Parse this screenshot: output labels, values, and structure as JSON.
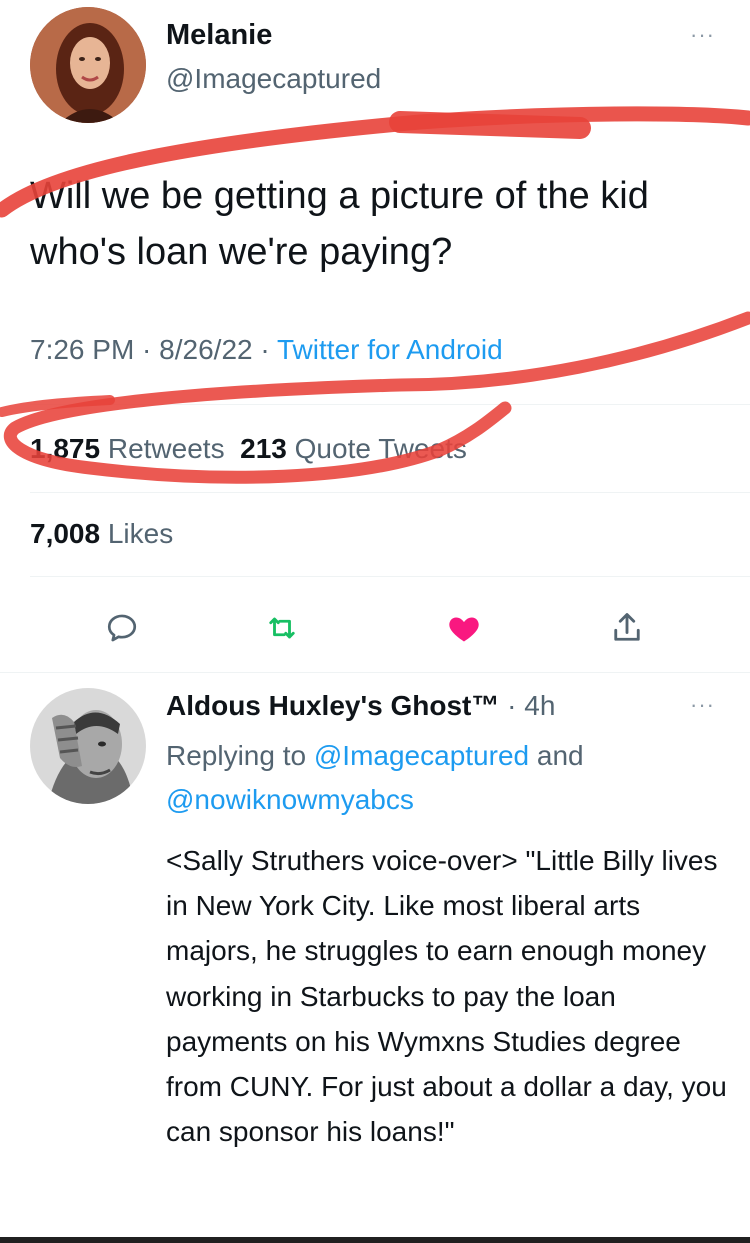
{
  "tweet": {
    "author_name": "Melanie",
    "author_handle": "@Imagecaptured",
    "more_label": "···",
    "text": "Will we be getting a picture of the kid who's loan we're paying?",
    "time": "7:26 PM",
    "date": "8/26/22",
    "source": "Twitter for Android",
    "separator": " · ",
    "retweets_count": "1,875",
    "retweets_label": "Retweets",
    "quotes_count": "213",
    "quotes_label": "Quote Tweets",
    "likes_count": "7,008",
    "likes_label": "Likes"
  },
  "actions": {
    "reply_icon": "speech-bubble-icon",
    "retweet_icon": "retweet-icon",
    "like_icon": "heart-icon",
    "share_icon": "share-icon",
    "liked": true
  },
  "reply": {
    "author_name": "Aldous Huxley's Ghost™",
    "time": "· 4h",
    "more_label": "···",
    "replying_prefix": "Replying to",
    "replying_handle_1": "@Imagecaptured",
    "replying_and": "and",
    "replying_handle_2": "@nowiknowmyabcs",
    "text": "<Sally Struthers voice-over> \"Little Billy lives in New York City. Like most liberal arts majors, he struggles to earn enough money working in Starbucks to pay the loan payments on his Wymxns Studies degree from CUNY. For just about a dollar a day, you can sponsor his loans!\""
  },
  "colors": {
    "text": "#0f1419",
    "secondary": "#536471",
    "link": "#1d9bf0",
    "like": "#f91880",
    "annotation": "#e8423a"
  }
}
